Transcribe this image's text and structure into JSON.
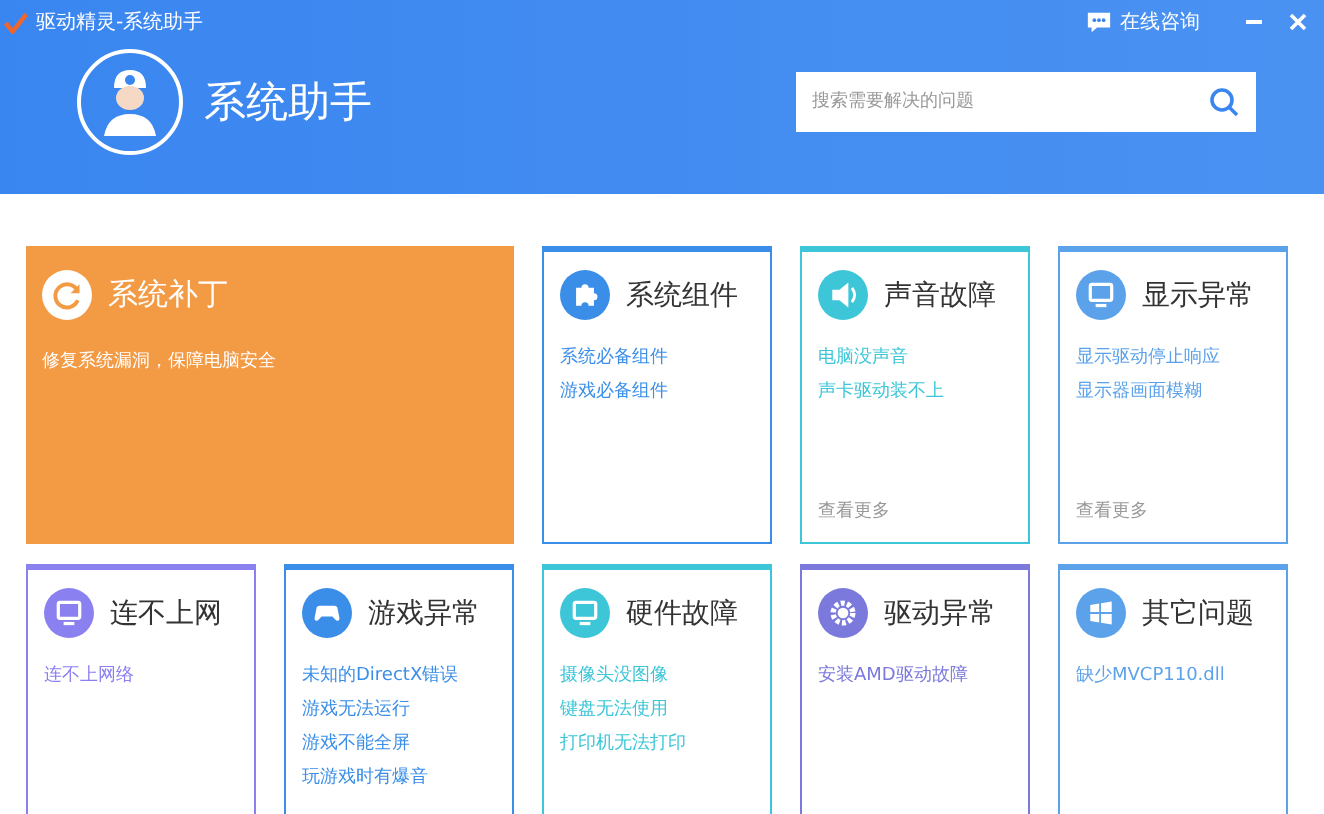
{
  "window": {
    "title": "驱动精灵-系统助手",
    "consult": "在线咨询"
  },
  "header": {
    "title": "系统助手",
    "search": {
      "placeholder": "搜索需要解决的问题"
    }
  },
  "feature": {
    "title": "系统补丁",
    "description": "修复系统漏洞，保障电脑安全"
  },
  "cards": [
    {
      "title": "系统组件",
      "kind": "puzzle",
      "color": "#3a8ee8",
      "links": [
        "系统必备组件",
        "游戏必备组件"
      ]
    },
    {
      "title": "声音故障",
      "kind": "speaker",
      "color": "#3cc6d8",
      "links": [
        "电脑没声音",
        "声卡驱动装不上"
      ],
      "more": "查看更多"
    },
    {
      "title": "显示异常",
      "kind": "monitor",
      "color": "#5ba2ea",
      "links": [
        "显示驱动停止响应",
        "显示器画面模糊"
      ],
      "more": "查看更多"
    },
    {
      "title": "连不上网",
      "kind": "network",
      "color": "#8b80f0",
      "links": [
        "连不上网络"
      ]
    },
    {
      "title": "游戏异常",
      "kind": "gamepad",
      "color": "#3a8ee8",
      "links": [
        "未知的DirectX错误",
        "游戏无法运行",
        "游戏不能全屏",
        "玩游戏时有爆音"
      ]
    },
    {
      "title": "硬件故障",
      "kind": "hardware",
      "color": "#3cc6d8",
      "links": [
        "摄像头没图像",
        "键盘无法使用",
        "打印机无法打印"
      ]
    },
    {
      "title": "驱动异常",
      "kind": "gear",
      "color": "#7b79dc",
      "links": [
        "安装AMD驱动故障"
      ]
    },
    {
      "title": "其它问题",
      "kind": "windows",
      "color": "#5ba2ea",
      "links": [
        "缺少MVCP110.dll"
      ]
    }
  ]
}
